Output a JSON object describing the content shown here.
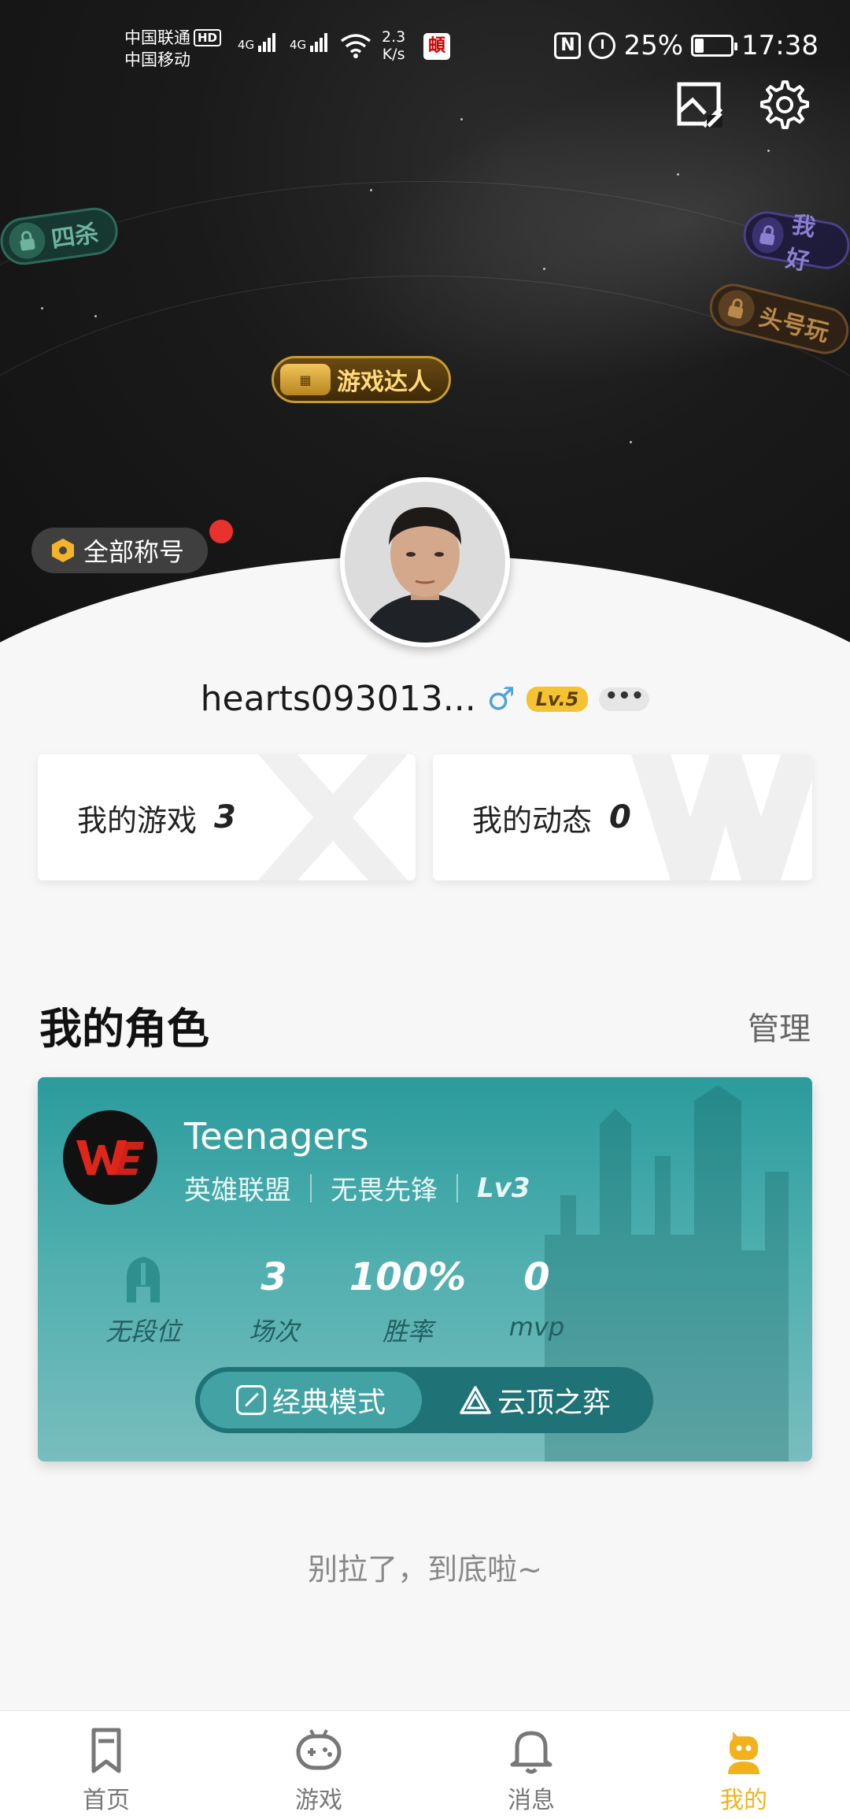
{
  "status_bar": {
    "carrier1": "中国联通",
    "carrier1_badge": "HD",
    "carrier2": "中国移动",
    "net1": "4G",
    "net2": "4G",
    "speed_value": "2.3",
    "speed_unit": "K/s",
    "nfc": "N",
    "battery_percent": "25%",
    "battery_level": 0.25,
    "time": "17:38"
  },
  "badges": {
    "left": "四杀",
    "right_top": "我好",
    "right_bottom": "头号玩",
    "center": "游戏达人"
  },
  "profile": {
    "all_titles_label": "全部称号",
    "username": "hearts093013...",
    "gender_symbol": "♂",
    "level": "Lv.5",
    "more": "•••"
  },
  "cards": {
    "games_label": "我的游戏",
    "games_count": "3",
    "posts_label": "我的动态",
    "posts_count": "0"
  },
  "roles": {
    "title": "我的角色",
    "manage_label": "管理",
    "role": {
      "name": "Teenagers",
      "game": "英雄联盟",
      "server": "无畏先锋",
      "level": "Lv3",
      "stats": [
        {
          "value": "",
          "label": "无段位"
        },
        {
          "value": "3",
          "label": "场次"
        },
        {
          "value": "100%",
          "label": "胜率"
        },
        {
          "value": "0",
          "label": "mvp"
        }
      ],
      "modes": [
        "经典模式",
        "云顶之弈"
      ]
    }
  },
  "end_text": "别拉了，到底啦~",
  "tabbar": [
    {
      "label": "首页",
      "icon": "bookmark-icon"
    },
    {
      "label": "游戏",
      "icon": "gamepad-icon"
    },
    {
      "label": "消息",
      "icon": "bell-icon"
    },
    {
      "label": "我的",
      "icon": "profile-icon"
    }
  ],
  "colors": {
    "accent": "#f2b21e",
    "role_card": "#4eaeae",
    "notification": "#e8322c"
  }
}
